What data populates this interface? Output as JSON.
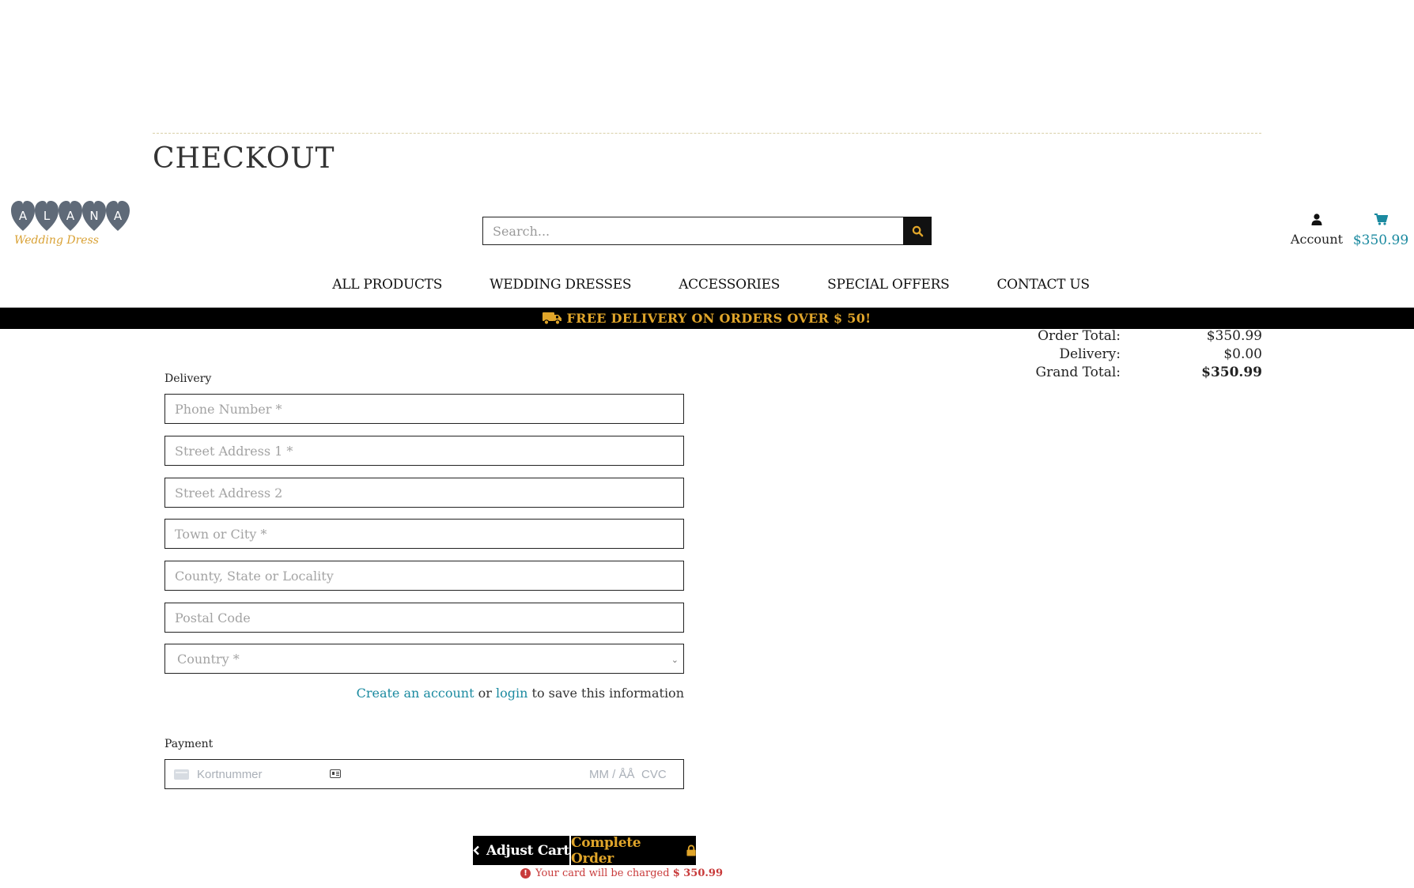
{
  "page": {
    "title": "CHECKOUT"
  },
  "logo": {
    "letters": [
      "A",
      "L",
      "A",
      "N",
      "A"
    ],
    "tagline": "Wedding Dress"
  },
  "search": {
    "placeholder": "Search..."
  },
  "header": {
    "account_label": "Account",
    "cart_total": "$350.99"
  },
  "nav": {
    "items": [
      "ALL PRODUCTS",
      "WEDDING DRESSES",
      "ACCESSORIES",
      "SPECIAL OFFERS",
      "CONTACT US"
    ]
  },
  "banner": {
    "text": "FREE DELIVERY ON ORDERS OVER $ 50!"
  },
  "totals": {
    "order_total_label": "Order Total:",
    "order_total": "$350.99",
    "delivery_label": "Delivery:",
    "delivery": "$0.00",
    "grand_total_label": "Grand Total:",
    "grand_total": "$350.99"
  },
  "delivery": {
    "section_label": "Delivery",
    "phone_placeholder": "Phone Number *",
    "street1_placeholder": "Street Address 1 *",
    "street2_placeholder": "Street Address 2",
    "town_placeholder": "Town or City *",
    "county_placeholder": "County, State or Locality",
    "postcode_placeholder": "Postal Code",
    "country_selected": "Country *"
  },
  "save_info": {
    "create_account": "Create an account",
    "or": "or",
    "login": "login",
    "suffix": "to save this information"
  },
  "payment": {
    "section_label": "Payment",
    "card_number_placeholder": "Kortnummer",
    "expiry_placeholder": "MM / ÅÅ",
    "cvc_placeholder": "CVC"
  },
  "actions": {
    "adjust_cart_label": "Adjust Cart",
    "complete_order_label": "Complete Order",
    "charge_note_text": "Your card will be charged",
    "charge_amount": "$ 350.99"
  },
  "colors": {
    "accent_gold": "#e0a52a",
    "link_teal": "#1b8aa0",
    "logo_grey": "#5f6a78",
    "error_red": "#c83a3a"
  }
}
